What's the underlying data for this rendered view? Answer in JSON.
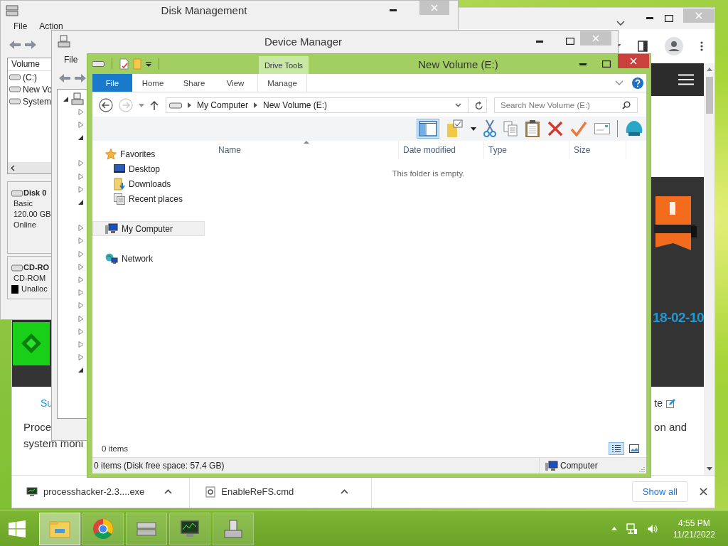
{
  "browser": {
    "page": {
      "link_left": "Su",
      "link_right": "te",
      "paragraph_left": [
        "Proce",
        "system moni"
      ],
      "paragraph_right": "on and",
      "date": "18-02-10"
    },
    "downloads": [
      {
        "name": "processhacker-2.3....exe"
      },
      {
        "name": "EnableReFS.cmd"
      }
    ],
    "show_all": "Show all"
  },
  "disk_management": {
    "title": "Disk Management",
    "menu": [
      "File",
      "Action"
    ],
    "volume_header": "Volume",
    "volumes": [
      "(C:)",
      "New Vo",
      "System"
    ],
    "disks": [
      {
        "name": "Disk 0",
        "lines": [
          "Basic",
          "120.00 GB",
          "Online"
        ]
      },
      {
        "name": "CD-RO",
        "lines": [
          "CD-ROM"
        ],
        "legend": "Unalloc"
      }
    ]
  },
  "device_manager": {
    "title": "Device Manager",
    "menu": [
      "File"
    ],
    "tree": {
      "expanded": true,
      "children": [
        {
          "expanded": false
        },
        {
          "expanded": false
        },
        {
          "expanded": true
        },
        {
          "expanded": false
        },
        {
          "expanded": false
        },
        {
          "expanded": false
        },
        {
          "expanded": true
        },
        {
          "expanded": false
        },
        {
          "expanded": false
        },
        {
          "expanded": false
        },
        {
          "expanded": false
        },
        {
          "expanded": false
        },
        {
          "expanded": false
        },
        {
          "expanded": false
        },
        {
          "expanded": false
        },
        {
          "expanded": false
        },
        {
          "expanded": false
        },
        {
          "expanded": false
        },
        {
          "expanded": true
        }
      ]
    }
  },
  "explorer": {
    "title": "New Volume (E:)",
    "contextual_group": "Drive Tools",
    "ribbon_tabs": [
      {
        "label": "File",
        "kind": "file",
        "selected": false
      },
      {
        "label": "Home",
        "kind": "tab",
        "selected": false
      },
      {
        "label": "Share",
        "kind": "tab",
        "selected": false
      },
      {
        "label": "View",
        "kind": "tab",
        "selected": false
      },
      {
        "label": "Manage",
        "kind": "contextual",
        "selected": false
      }
    ],
    "address": [
      "My Computer",
      "New Volume (E:)"
    ],
    "search": {
      "placeholder": "Search New Volume (E:)"
    },
    "preview_pane": {
      "on": true
    },
    "nav": [
      {
        "label": "Favorites",
        "selected": false,
        "children": [
          {
            "label": "Desktop",
            "selected": false
          },
          {
            "label": "Downloads",
            "selected": false
          },
          {
            "label": "Recent places",
            "selected": false
          }
        ]
      },
      {
        "label": "My Computer",
        "selected": true
      },
      {
        "label": "Network",
        "selected": false
      }
    ],
    "columns": [
      "Name",
      "Date modified",
      "Type",
      "Size"
    ],
    "empty_message": "This folder is empty.",
    "item_count": "0 items",
    "view_buttons": [
      {
        "selected": true
      },
      {
        "selected": false
      }
    ],
    "status": {
      "text": "0 items (Disk free space: 57.4 GB)",
      "location": "Computer"
    }
  },
  "taskbar": {
    "apps": [
      {
        "selected": true
      },
      {
        "selected": false
      },
      {
        "selected": false
      },
      {
        "selected": false
      },
      {
        "selected": false
      }
    ],
    "time": "4:55 PM",
    "date": "11/21/2022"
  }
}
